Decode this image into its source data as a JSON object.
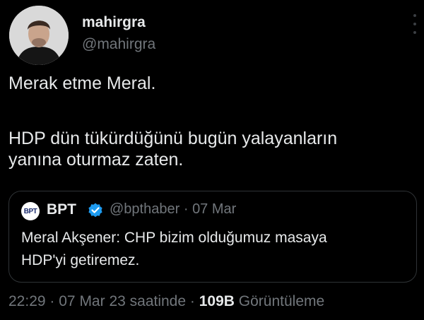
{
  "author": {
    "name": "mahirgra",
    "handle": "@mahirgra",
    "avatar_icon": "profile-photo"
  },
  "tweet": {
    "lines": [
      "Merak etme Meral.",
      "HDP dün tükürdüğünü bugün yalayanların",
      "yanına oturmaz zaten."
    ]
  },
  "quoted_tweet": {
    "logo_text": "BPT",
    "name": "BPT",
    "verified_icon": "verified-badge",
    "handle": "@bpthaber",
    "separator": "·",
    "date": "07 Mar",
    "lines": [
      "Meral Akşener: CHP bizim olduğumuz masaya",
      "HDP'yi getiremez."
    ]
  },
  "footer": {
    "time": "22:29",
    "sep1": "·",
    "date": "07 Mar 23 saatinde",
    "sep2": "·",
    "views_count": "109B",
    "views_label": "Görüntüleme"
  },
  "colors": {
    "background": "#000000",
    "text": "#e7e9ea",
    "muted": "#71767b",
    "border": "#2f3336",
    "verified": "#1d9bf0"
  }
}
